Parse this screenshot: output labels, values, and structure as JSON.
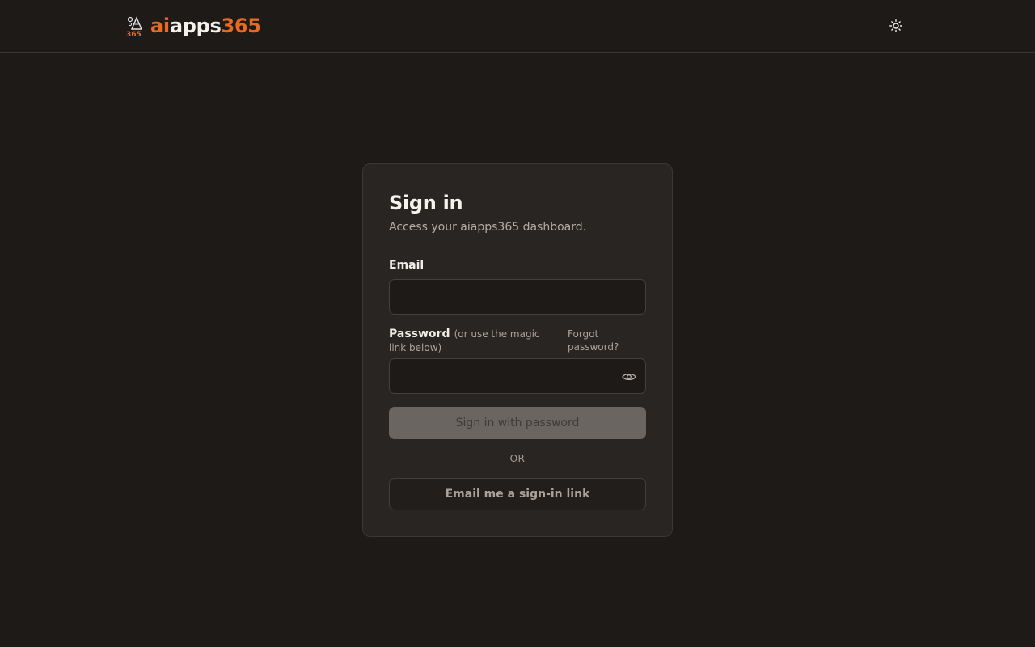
{
  "header": {
    "brand": {
      "ai": "ai",
      "apps": "apps",
      "num": "365"
    },
    "theme_icon": "sun-icon"
  },
  "signin": {
    "title": "Sign in",
    "subtitle": "Access your aiapps365 dashboard.",
    "email_label": "Email",
    "email_value": "",
    "password_label": "Password",
    "password_hint": "(or use the magic link below)",
    "forgot_password": "Forgot password?",
    "password_value": "",
    "password_icon": "eye-icon",
    "submit_label": "Sign in with password",
    "divider_text": "OR",
    "magic_link_label": "Email me a sign-in link"
  },
  "colors": {
    "background": "#1e1a18",
    "card": "#292523",
    "accent": "#e86a1f",
    "disabled_button": "#6b6562"
  }
}
